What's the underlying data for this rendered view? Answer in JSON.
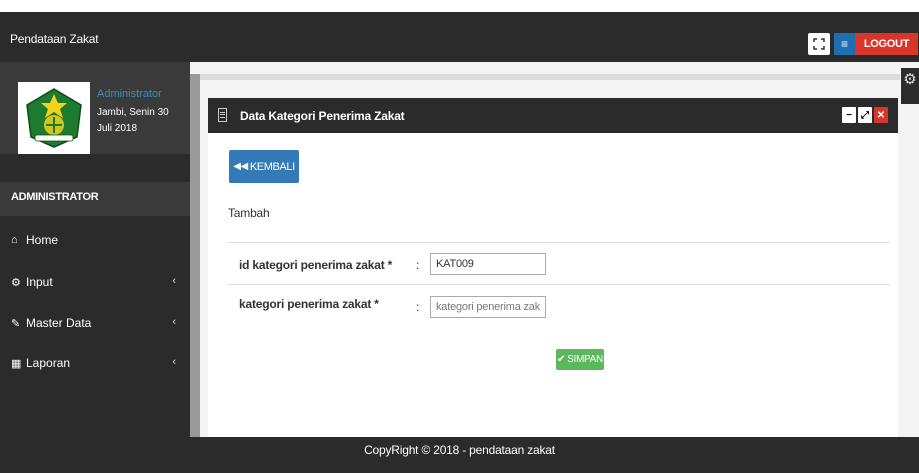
{
  "navbar": {
    "brand": "Pendataan Zakat",
    "fullscreen_icon": "fullscreen-icon",
    "logout_label": "LOGOUT",
    "logout_icon": "menu-icon"
  },
  "sidebar": {
    "role": "Administrator",
    "date": "Jambi, Senin 30 Juli 2018",
    "header": "ADMINISTRATOR",
    "items": [
      {
        "label": "Home",
        "icon": "home-icon"
      },
      {
        "label": "Input",
        "icon": "cogs-icon"
      },
      {
        "label": "Master Data",
        "icon": "edit-icon"
      },
      {
        "label": "Laporan",
        "icon": "calendar-icon"
      }
    ]
  },
  "panel": {
    "title": "Data Kategori Penerima Zakat",
    "back_label": "KEMBALI",
    "sub_label": "Tambah",
    "fields": [
      {
        "label": "id kategori penerima zakat *",
        "value": "KAT009",
        "placeholder": ""
      },
      {
        "label": "kategori penerima zakat *",
        "value": "",
        "placeholder": "kategori penerima zakat"
      }
    ],
    "colon": ":",
    "save_label": "SIMPAN"
  },
  "footer": {
    "text": "CopyRight © 2018 - pendataan zakat"
  },
  "colors": {
    "dark": "#2b2b2b",
    "primary": "#337ab7",
    "danger": "#d9352a",
    "success": "#5cb85c",
    "link": "#3c8dbc"
  }
}
